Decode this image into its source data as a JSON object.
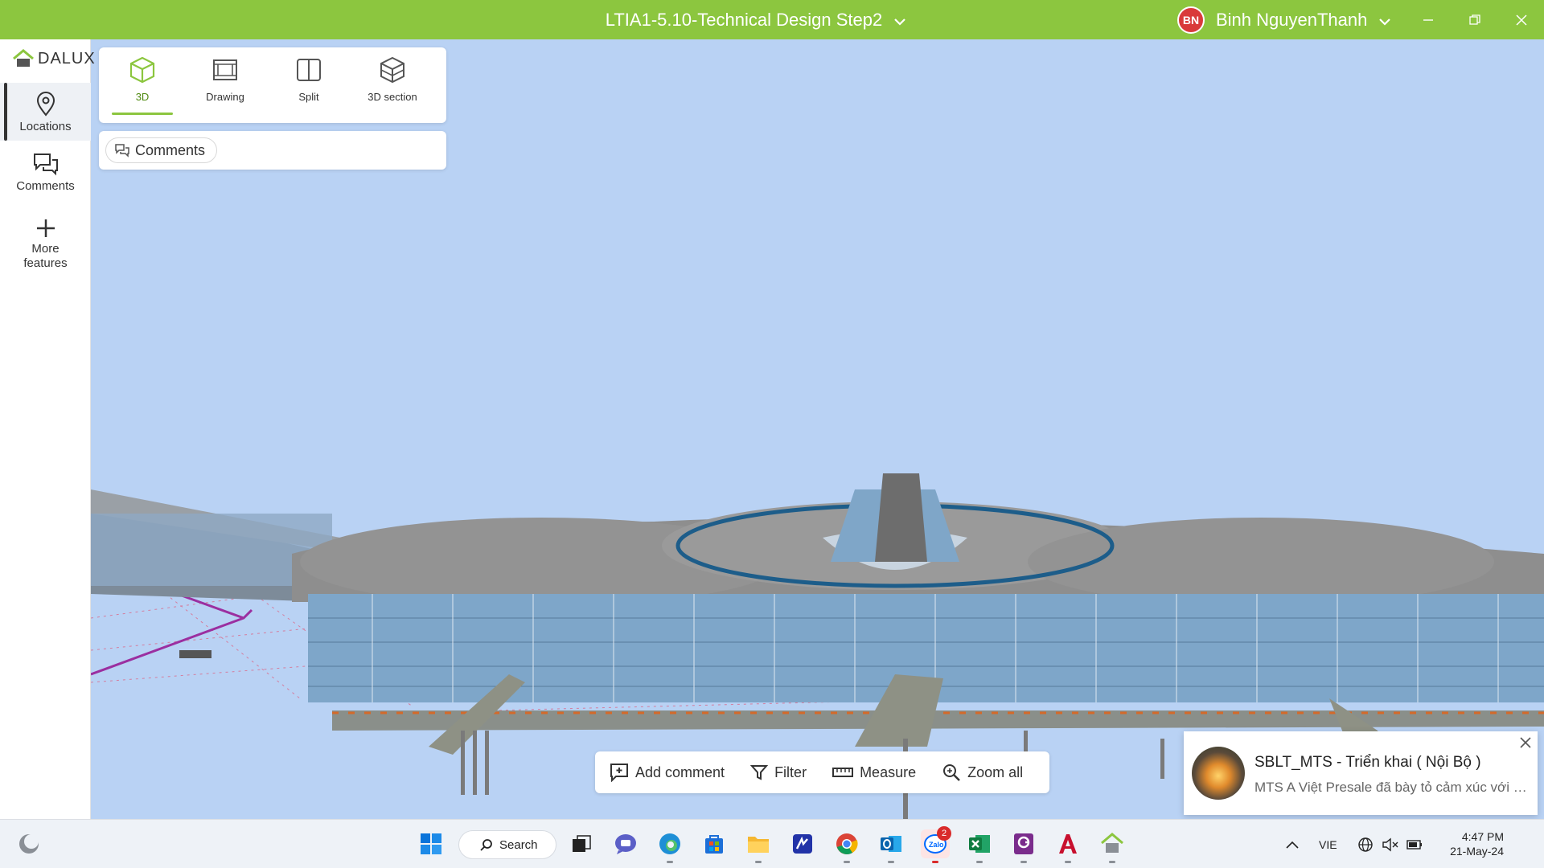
{
  "titlebar": {
    "project_title": "LTIA1-5.10-Technical Design Step2",
    "user_initials": "BN",
    "user_name": "Binh NguyenThanh",
    "accent": "#8cc63f"
  },
  "sidebar": {
    "logo_text": "DALUX",
    "items": [
      {
        "label": "Locations",
        "icon": "location-pin-icon",
        "active": true
      },
      {
        "label": "Comments",
        "icon": "comments-icon"
      },
      {
        "label": "More\nfeatures",
        "icon": "plus-icon"
      }
    ]
  },
  "view_modes": [
    {
      "label": "3D",
      "icon": "cube-icon",
      "active": true
    },
    {
      "label": "Drawing",
      "icon": "drawing-icon"
    },
    {
      "label": "Split",
      "icon": "split-icon"
    },
    {
      "label": "3D section",
      "icon": "section-cube-icon"
    }
  ],
  "comments_panel": {
    "chip_label": "Comments"
  },
  "toolbar": {
    "add_comment": "Add comment",
    "filter": "Filter",
    "measure": "Measure",
    "zoom_all": "Zoom all"
  },
  "notification": {
    "title": "SBLT_MTS - Triển khai ( Nội Bộ )",
    "body": "MTS A Việt Presale đã bày tỏ cảm xúc với t..."
  },
  "taskbar": {
    "search_label": "Search",
    "zalo_badge": "2",
    "language": "VIE",
    "time": "4:47 PM",
    "date": "21-May-24"
  }
}
